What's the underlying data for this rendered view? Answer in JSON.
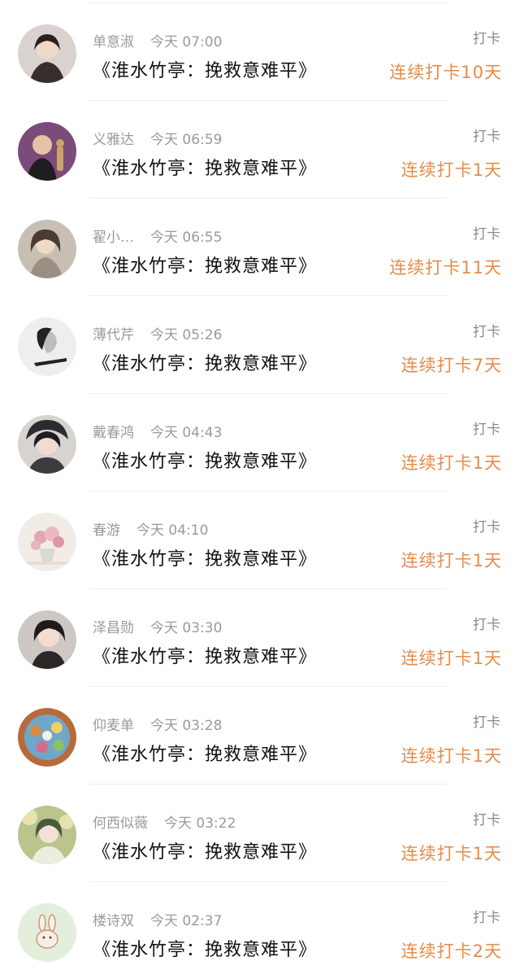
{
  "checkins": [
    {
      "user": "单意淑",
      "time": "今天 07:00",
      "title": "《淮水竹亭：挽救意难平》",
      "action": "打卡",
      "streak": "连续打卡10天",
      "avatar_icon": "user-photo-avatar",
      "avatar_colors": [
        "#d9d2ce",
        "#3a2e2c"
      ]
    },
    {
      "user": "义雅达",
      "time": "今天 06:59",
      "title": "《淮水竹亭：挽救意难平》",
      "action": "打卡",
      "streak": "连续打卡1天",
      "avatar_icon": "user-photo-avatar",
      "avatar_colors": [
        "#7b4b79",
        "#c9a36a"
      ]
    },
    {
      "user": "翟小…",
      "time": "今天 06:55",
      "title": "《淮水竹亭：挽救意难平》",
      "action": "打卡",
      "streak": "连续打卡11天",
      "avatar_icon": "user-photo-avatar",
      "avatar_colors": [
        "#c8bfb4",
        "#4a3b33"
      ]
    },
    {
      "user": "薄代芹",
      "time": "今天 05:26",
      "title": "《淮水竹亭：挽救意难平》",
      "action": "打卡",
      "streak": "连续打卡7天",
      "avatar_icon": "user-photo-avatar",
      "avatar_colors": [
        "#eeeeee",
        "#222222"
      ]
    },
    {
      "user": "戴春鸿",
      "time": "今天 04:43",
      "title": "《淮水竹亭：挽救意难平》",
      "action": "打卡",
      "streak": "连续打卡1天",
      "avatar_icon": "user-photo-avatar",
      "avatar_colors": [
        "#d7d3cf",
        "#2b2b33"
      ]
    },
    {
      "user": "春游",
      "time": "今天 04:10",
      "title": "《淮水竹亭：挽救意难平》",
      "action": "打卡",
      "streak": "连续打卡1天",
      "avatar_icon": "flower-photo-avatar",
      "avatar_colors": [
        "#f1ece6",
        "#e3a6b2"
      ]
    },
    {
      "user": "泽昌勋",
      "time": "今天 03:30",
      "title": "《淮水竹亭：挽救意难平》",
      "action": "打卡",
      "streak": "连续打卡1天",
      "avatar_icon": "user-photo-avatar",
      "avatar_colors": [
        "#cfc7c3",
        "#1f1b1b"
      ]
    },
    {
      "user": "仰麦单",
      "time": "今天 03:28",
      "title": "《淮水竹亭：挽救意难平》",
      "action": "打卡",
      "streak": "连续打卡1天",
      "avatar_icon": "cartoon-avatar",
      "avatar_colors": [
        "#6fa6c9",
        "#d98b3e"
      ]
    },
    {
      "user": "何西似薇",
      "time": "今天 03:22",
      "title": "《淮水竹亭：挽救意难平》",
      "action": "打卡",
      "streak": "连续打卡1天",
      "avatar_icon": "illustration-avatar",
      "avatar_colors": [
        "#b9c58c",
        "#4b5a3c"
      ]
    },
    {
      "user": "楼诗双",
      "time": "今天 02:37",
      "title": "《淮水竹亭：挽救意难平》",
      "action": "打卡",
      "streak": "连续打卡2天",
      "avatar_icon": "bunny-avatar",
      "avatar_colors": [
        "#e3efdc",
        "#c79a78"
      ]
    }
  ]
}
